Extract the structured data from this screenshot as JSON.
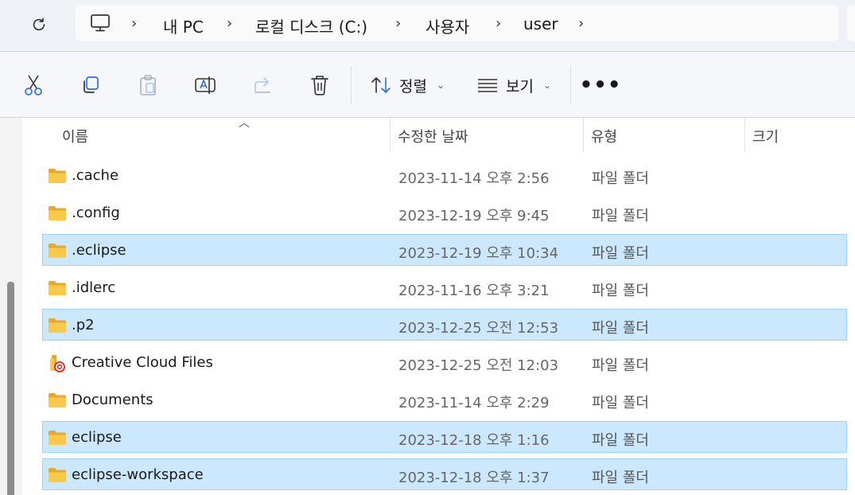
{
  "address_bar": {
    "breadcrumb": [
      "내 PC",
      "로컬 디스크 (C:)",
      "사용자",
      "user"
    ]
  },
  "toolbar": {
    "cut_icon": "scissors-icon",
    "copy_icon": "copy-icon",
    "paste_icon": "clipboard-icon",
    "rename_icon": "rename-icon",
    "share_icon": "share-icon",
    "delete_icon": "trash-icon",
    "sort_label": "정렬",
    "view_label": "보기",
    "more_label": "•••"
  },
  "columns": {
    "name": "이름",
    "modified": "수정한 날짜",
    "type": "유형",
    "size": "크기"
  },
  "files": [
    {
      "name": ".cache",
      "modified": "2023-11-14 오후 2:56",
      "type": "파일 폴더",
      "selected": false,
      "icon": "folder-icon"
    },
    {
      "name": ".config",
      "modified": "2023-12-19 오후 9:45",
      "type": "파일 폴더",
      "selected": false,
      "icon": "folder-icon"
    },
    {
      "name": ".eclipse",
      "modified": "2023-12-19 오후 10:34",
      "type": "파일 폴더",
      "selected": true,
      "icon": "folder-icon"
    },
    {
      "name": ".idlerc",
      "modified": "2023-11-16 오후 3:21",
      "type": "파일 폴더",
      "selected": false,
      "icon": "folder-icon"
    },
    {
      "name": ".p2",
      "modified": "2023-12-25 오전 12:53",
      "type": "파일 폴더",
      "selected": true,
      "icon": "folder-icon"
    },
    {
      "name": "Creative Cloud Files",
      "modified": "2023-12-25 오전 12:03",
      "type": "파일 폴더",
      "selected": false,
      "icon": "creative-cloud-folder-icon"
    },
    {
      "name": "Documents",
      "modified": "2023-11-14 오후 2:29",
      "type": "파일 폴더",
      "selected": false,
      "icon": "folder-icon"
    },
    {
      "name": "eclipse",
      "modified": "2023-12-18 오후 1:16",
      "type": "파일 폴더",
      "selected": true,
      "icon": "folder-icon"
    },
    {
      "name": "eclipse-workspace",
      "modified": "2023-12-18 오후 1:37",
      "type": "파일 폴더",
      "selected": true,
      "icon": "folder-icon"
    }
  ],
  "colors": {
    "selection_bg": "#cce8ff",
    "selection_border": "#99d1ff",
    "folder_yellow": "#f8c94a"
  }
}
